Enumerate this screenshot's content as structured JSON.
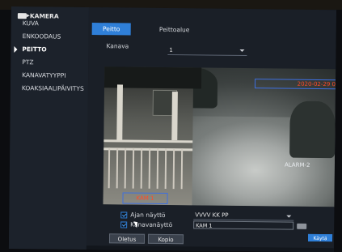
{
  "sidebar": {
    "header": "KAMERA",
    "items": [
      {
        "label": "KUVA"
      },
      {
        "label": "ENKOODAUS"
      },
      {
        "label": "PEITTO"
      },
      {
        "label": "PTZ"
      },
      {
        "label": "KANAVATYYPPI"
      },
      {
        "label": "KOAKSIAALIPÄIVITYS"
      }
    ],
    "active_index": 2
  },
  "tabs": [
    {
      "label": "Peitto"
    },
    {
      "label": "Peittoalue"
    }
  ],
  "channel": {
    "label": "Kanava",
    "value": "1"
  },
  "preview": {
    "date_overlay": "2020-02-29 01:02:06",
    "alarm_overlay": "ALARM-2",
    "camera_overlay": "KAM 1"
  },
  "options": {
    "time_display": {
      "label": "Ajan näyttö",
      "value": "VVVV KK PP"
    },
    "channel_display": {
      "label": "Kanavanäyttö",
      "value": "KAM 1"
    }
  },
  "buttons": {
    "default": "Oletus",
    "copy": "Kopio",
    "apply": "Käytä"
  },
  "colors": {
    "accent": "#2f7fd8",
    "overlay_text": "#ff4b28",
    "overlay_border": "#3d6fe0"
  },
  "icons": {
    "header": "camera-icon",
    "active_marker": "triangle-right-icon"
  }
}
